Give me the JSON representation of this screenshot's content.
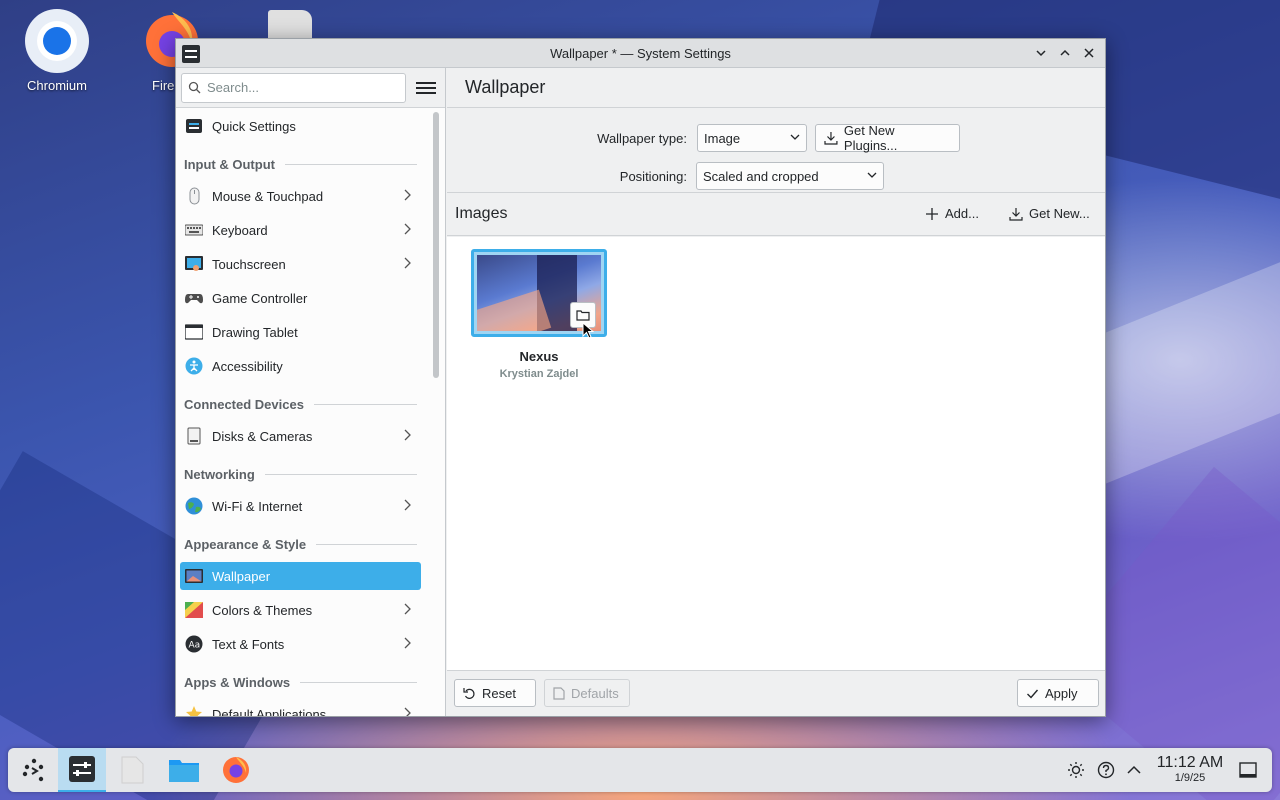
{
  "desktop": {
    "icons": [
      {
        "label": "Chromium"
      },
      {
        "label": "Fire"
      }
    ]
  },
  "window": {
    "title": "Wallpaper * — System Settings",
    "controls": {
      "minimize": "⌵",
      "maximize": "⌃",
      "close": "✕"
    }
  },
  "sidebar": {
    "search_placeholder": "Search...",
    "items": {
      "quick_settings": "Quick Settings",
      "section_input_output": "Input & Output",
      "mouse_touchpad": "Mouse & Touchpad",
      "keyboard": "Keyboard",
      "touchscreen": "Touchscreen",
      "game_controller": "Game Controller",
      "drawing_tablet": "Drawing Tablet",
      "accessibility": "Accessibility",
      "section_connected_devices": "Connected Devices",
      "disks_cameras": "Disks & Cameras",
      "section_networking": "Networking",
      "wifi_internet": "Wi-Fi & Internet",
      "section_appearance_style": "Appearance & Style",
      "wallpaper": "Wallpaper",
      "colors_themes": "Colors & Themes",
      "text_fonts": "Text & Fonts",
      "section_apps_windows": "Apps & Windows",
      "default_applications": "Default Applications"
    }
  },
  "main": {
    "title": "Wallpaper",
    "wallpaper_type_label": "Wallpaper type:",
    "wallpaper_type_value": "Image",
    "get_new_plugins": "Get New Plugins...",
    "positioning_label": "Positioning:",
    "positioning_value": "Scaled and cropped",
    "images_title": "Images",
    "add_label": "Add...",
    "get_new_label": "Get New...",
    "wallpapers": [
      {
        "name": "Nexus",
        "author": "Krystian Zajdel"
      }
    ],
    "reset_label": "Reset",
    "defaults_label": "Defaults",
    "apply_label": "Apply"
  },
  "taskbar": {
    "clock_time": "11:12 AM",
    "clock_date": "1/9/25"
  },
  "colors": {
    "accent": "#3daee9",
    "window_bg": "#eff0f1",
    "sidebar_bg": "#fcfcfc"
  }
}
